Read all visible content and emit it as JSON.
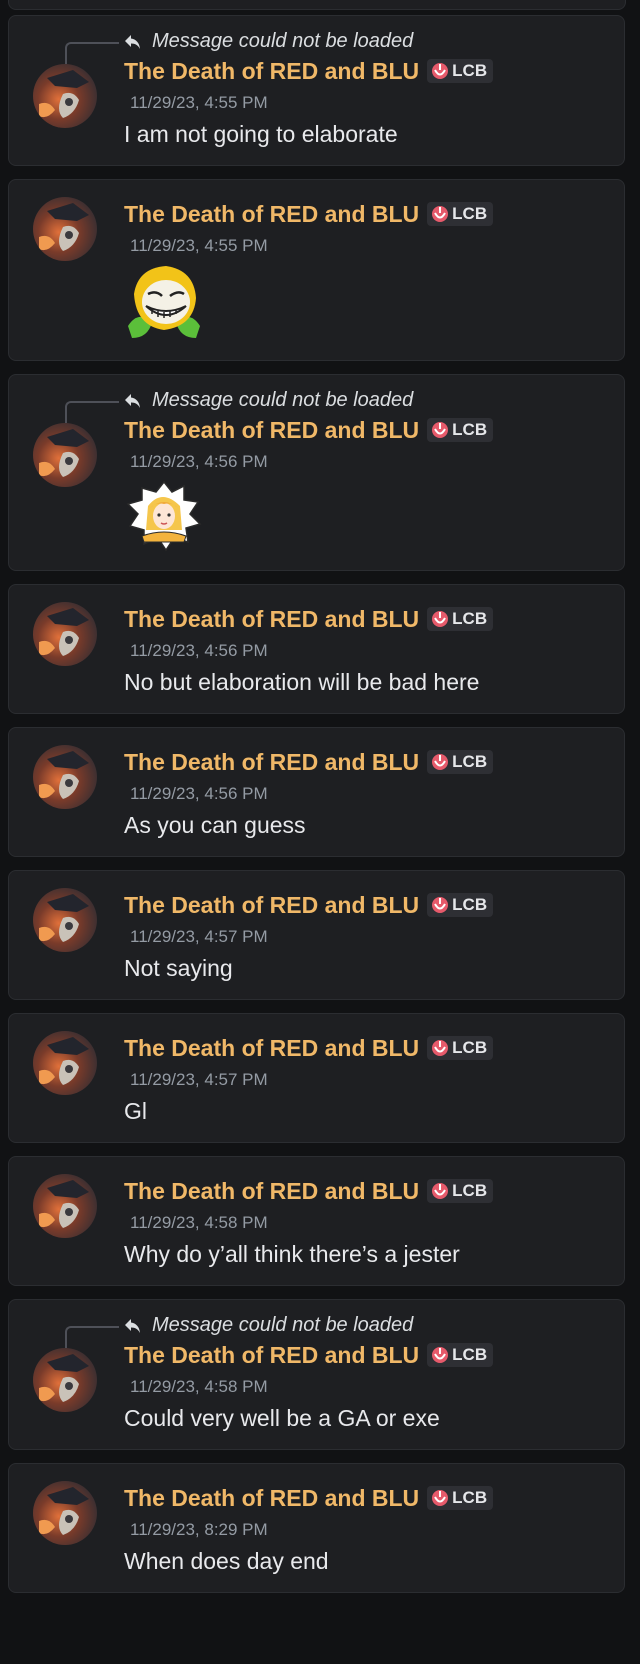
{
  "messages": [
    {
      "reply": "Message could not be loaded",
      "author": "The Death of RED and BLU",
      "tag": "LCB",
      "time": "11/29/23, 4:55 PM",
      "text": "I am not going to elaborate"
    },
    {
      "reply": null,
      "author": "The Death of RED and BLU",
      "tag": "LCB",
      "time": "11/29/23, 4:55 PM",
      "sticker": "trollface-flower-sticker"
    },
    {
      "reply": "Message could not be loaded",
      "author": "The Death of RED and BLU",
      "tag": "LCB",
      "time": "11/29/23, 4:56 PM",
      "sticker": "anime-girl-badge-sticker"
    },
    {
      "reply": null,
      "author": "The Death of RED and BLU",
      "tag": "LCB",
      "time": "11/29/23, 4:56 PM",
      "text": "No but elaboration will be bad here"
    },
    {
      "reply": null,
      "author": "The Death of RED and BLU",
      "tag": "LCB",
      "time": "11/29/23, 4:56 PM",
      "text": "As you can guess"
    },
    {
      "reply": null,
      "author": "The Death of RED and BLU",
      "tag": "LCB",
      "time": "11/29/23, 4:57 PM",
      "text": "Not saying"
    },
    {
      "reply": null,
      "author": "The Death of RED and BLU",
      "tag": "LCB",
      "time": "11/29/23, 4:57 PM",
      "text": "Gl"
    },
    {
      "reply": null,
      "author": "The Death of RED and BLU",
      "tag": "LCB",
      "time": "11/29/23, 4:58 PM",
      "text": "Why do y’all think there’s a jester"
    },
    {
      "reply": "Message could not be loaded",
      "author": "The Death of RED and BLU",
      "tag": "LCB",
      "time": "11/29/23, 4:58 PM",
      "text": "Could very well be a GA or exe"
    },
    {
      "reply": null,
      "author": "The Death of RED and BLU",
      "tag": "LCB",
      "time": "11/29/23, 8:29 PM",
      "text": "When does day end"
    }
  ],
  "colors": {
    "author": "#f0b868",
    "background": "#111214",
    "card": "#1e1f22"
  }
}
